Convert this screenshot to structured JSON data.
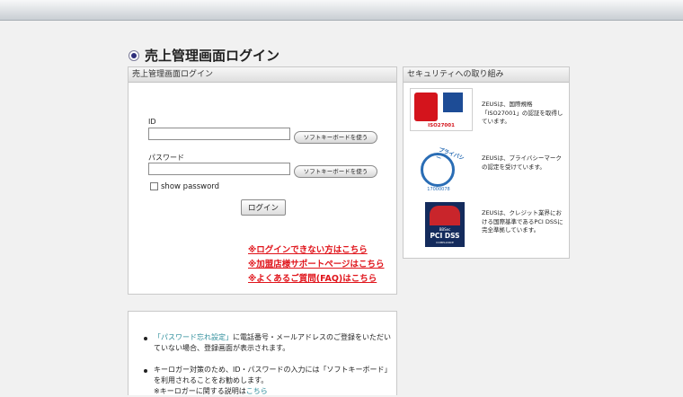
{
  "page": {
    "title": "売上管理画面ログイン"
  },
  "login_panel": {
    "header": "売上管理画面ログイン",
    "id_label": "ID",
    "password_label": "パスワード",
    "soft_keyboard_label": "ソフトキーボードを使う",
    "show_password_label": "show password",
    "show_password_checked": false,
    "login_button": "ログイン",
    "links": [
      "※ログインできない方はこちら",
      "※加盟店様サポートページはこちら",
      "※よくあるご質問(FAQ)はこちら"
    ]
  },
  "security_panel": {
    "header": "セキュリティへの取り組み",
    "items": [
      {
        "text": "ZEUSは、国際規格「ISO27001」の認証を取得しています。",
        "badge_label": "ISO27001"
      },
      {
        "text": "ZEUSは、プライバシーマークの認定を受けています。",
        "badge_text": "プライバシー",
        "badge_number": "17000078"
      },
      {
        "text": "ZEUSは、クレジット業界における国際基準であるPCI DSSに完全準拠しています。",
        "badge_top": "BBSec",
        "badge_main": "PCI DSS",
        "badge_sub": "COMPLIANCE"
      }
    ]
  },
  "info_panel": {
    "item1_link": "「パスワード忘れ設定」",
    "item1_text": "に電話番号・メールアドレスのご登録をいただいていない場合、登録画面が表示されます。",
    "item2_text": "キーロガー対策のため、ID・パスワードの入力には「ソフトキーボード」を利用されることをお勧めします。",
    "item2_note": "※キーロガーに関する説明は",
    "item2_link": "こちら"
  },
  "colors": {
    "link_red": "#e0141b",
    "teal_link": "#2b8c9a",
    "background": "#f1f1f1"
  }
}
